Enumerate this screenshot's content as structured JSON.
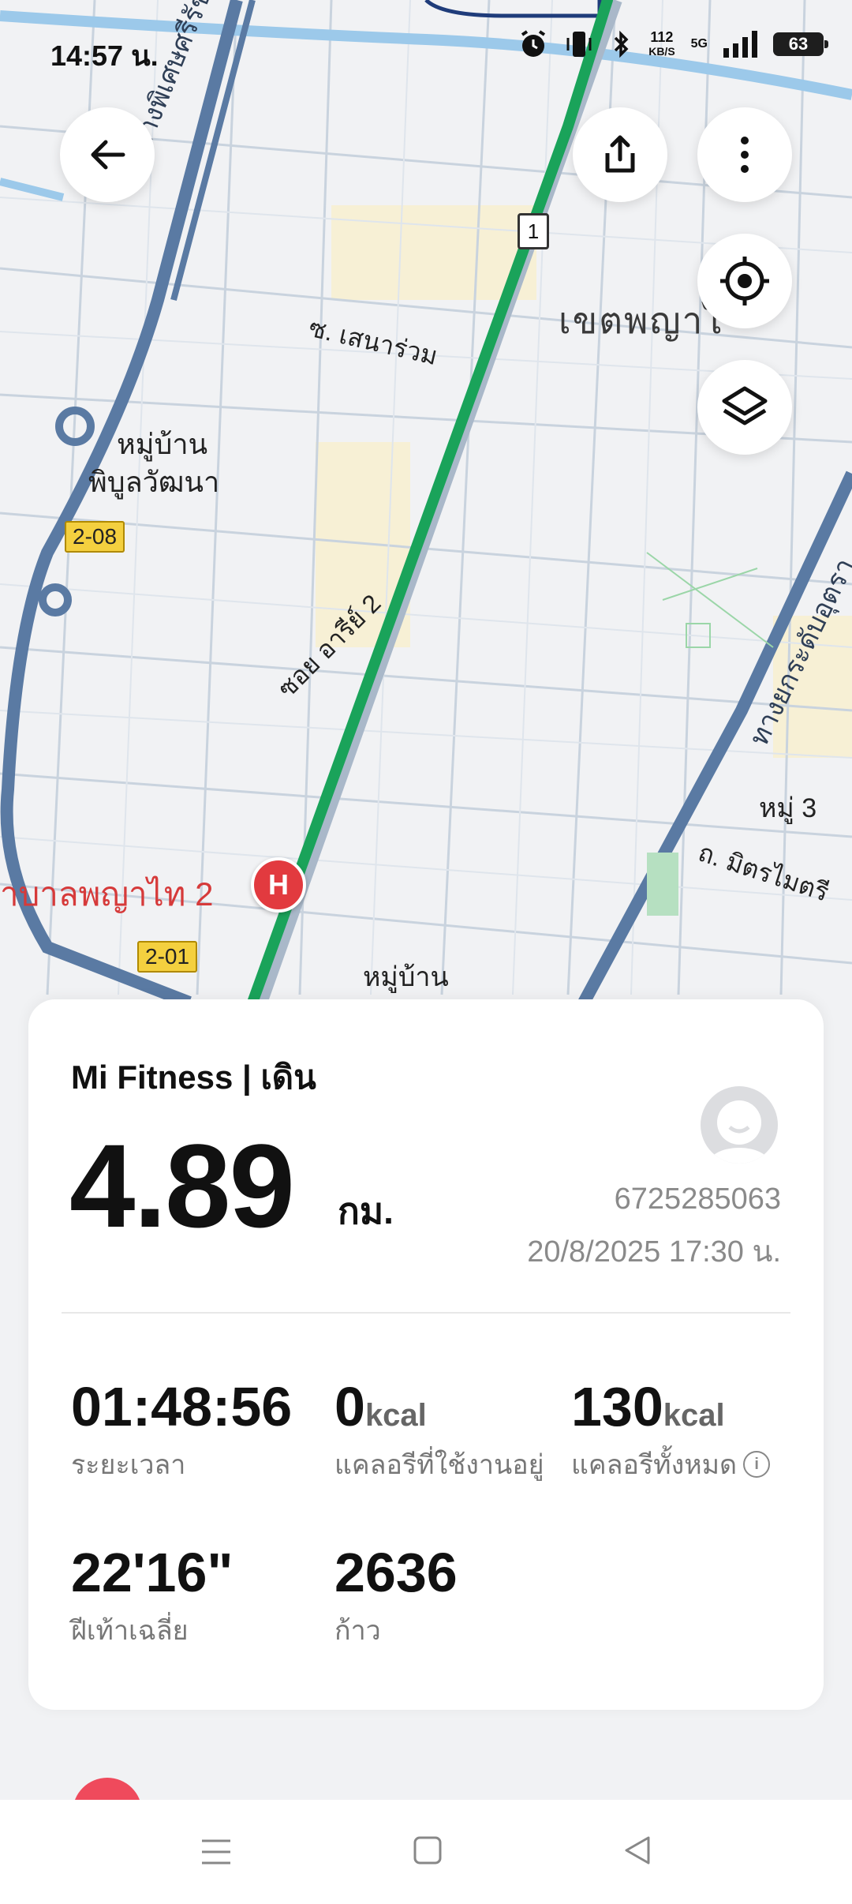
{
  "status_bar": {
    "time": "14:57 น.",
    "net_speed": "112",
    "net_unit": "KB/S",
    "network": "5G",
    "battery": "63",
    "icons": [
      "alarm-icon",
      "vibrate-icon",
      "bluetooth-icon",
      "signal-icon",
      "battery-icon"
    ]
  },
  "map": {
    "labels": {
      "road_phet": "ทางพิเศษศรีรัช",
      "district": "เขตพญาไ",
      "soi_senarom": "ซ. เสนาร่วม",
      "village_1": "หมู่บ้าน",
      "village_1b": "พิบูลวัฒนา",
      "soi_ari": "ซอย อารีย์ 2",
      "expressway_right": "ทางยกระดับอุตรา",
      "moo3": "หมู่ 3",
      "mitmaitri": "ถ. มิตรไมตรี",
      "hospital": "าบาลพญาไท 2",
      "village_bottom": "หมู่บ้าน",
      "route_no": "1",
      "tag_208": "2-08",
      "tag_201": "2-01",
      "hospital_letter": "H"
    },
    "colors": {
      "route": "#1aa35a",
      "expressway": "#5a7aa3",
      "road": "#b9c7d6",
      "water": "#9cc9ea"
    }
  },
  "buttons": {
    "back": "back-arrow-icon",
    "share": "share-icon",
    "more": "more-vertical-icon",
    "locate": "target-icon",
    "layers": "layers-icon"
  },
  "summary": {
    "source": "Mi Fitness | เดิน",
    "distance": "4.89",
    "distance_unit": "กม.",
    "user_id": "6725285063",
    "datetime": "20/8/2025 17:30 น.",
    "stats": [
      {
        "value": "01:48:56",
        "unit": "",
        "label": "ระยะเวลา"
      },
      {
        "value": "0",
        "unit": "kcal",
        "label": "แคลอรีที่ใช้งานอยู่"
      },
      {
        "value": "130",
        "unit": "kcal",
        "label": "แคลอรีทั้งหมด"
      },
      {
        "value": "22'16\"",
        "unit": "",
        "label": "ฝีเท้าเฉลี่ย"
      },
      {
        "value": "2636",
        "unit": "",
        "label": "ก้าว"
      }
    ]
  },
  "nav": {
    "icons": [
      "menu-icon",
      "home-icon",
      "back-icon"
    ]
  }
}
